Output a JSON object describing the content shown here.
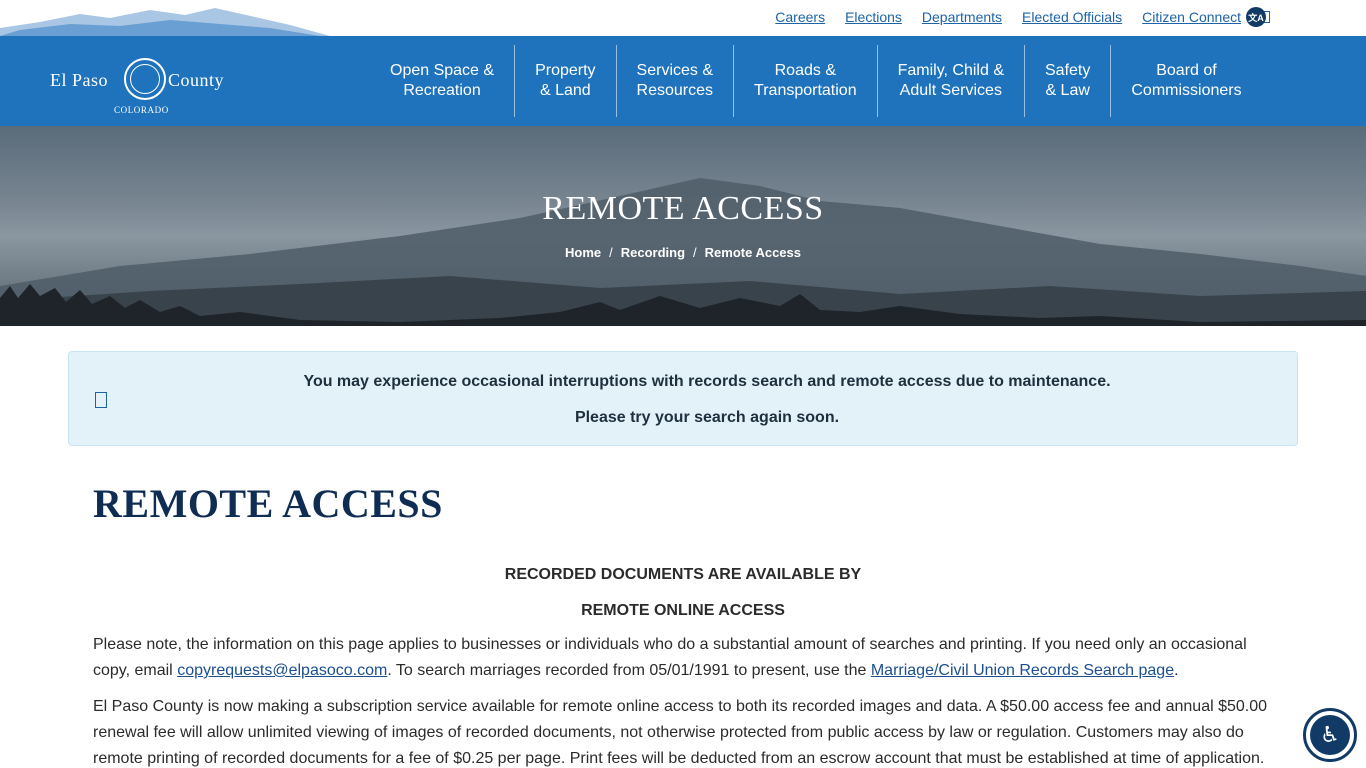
{
  "utility_nav": {
    "links": [
      "Careers",
      "Elections",
      "Departments",
      "Elected Officials",
      "Citizen Connect"
    ]
  },
  "logo": {
    "left_word": "El Paso",
    "right_word": "County",
    "subtitle": "COLORADO"
  },
  "main_nav": {
    "items": [
      {
        "line1": "Open Space &",
        "line2": "Recreation"
      },
      {
        "line1": "Property",
        "line2": "& Land"
      },
      {
        "line1": "Services &",
        "line2": "Resources"
      },
      {
        "line1": "Roads &",
        "line2": "Transportation"
      },
      {
        "line1": "Family, Child &",
        "line2": "Adult Services"
      },
      {
        "line1": "Safety",
        "line2": "& Law"
      },
      {
        "line1": "Board of",
        "line2": "Commissioners"
      }
    ]
  },
  "hero": {
    "title": "REMOTE ACCESS",
    "breadcrumb": [
      "Home",
      "Recording",
      "Remote Access"
    ]
  },
  "alert": {
    "line1": "You may experience occasional interruptions with records search and remote access due to maintenance.",
    "line2": "Please try your search again soon."
  },
  "content": {
    "heading": "REMOTE ACCESS",
    "subheading1": "RECORDED DOCUMENTS ARE AVAILABLE BY",
    "subheading2": "REMOTE ONLINE ACCESS",
    "p1_before": "Please note, the information on this page applies to businesses or individuals who do a substantial amount of searches and printing. If you need only an occasional copy, email ",
    "p1_email": "copyrequests@elpasoco.com",
    "p1_middle": ". To search marriages recorded from 05/01/1991 to present, use the ",
    "p1_link": "Marriage/Civil Union Records Search page",
    "p1_after": ".",
    "p2": "El Paso County is now making a subscription service available for remote online access to both its recorded images and data. A $50.00 access fee and annual $50.00 renewal fee will allow unlimited viewing of images of recorded documents, not otherwise protected from public access by law or regulation. Customers may also do remote printing of recorded documents for a fee of $0.25 per page. Print fees will be deducted from an escrow account that must be established at time of application."
  },
  "colors": {
    "nav_blue": "#1f73bd",
    "heading_navy": "#0f2d52",
    "alert_bg": "#e3f2f9",
    "link_blue": "#1c63a8"
  },
  "icons": {
    "search": "search-icon",
    "translate": "translate-icon",
    "alert": "info-icon",
    "accessibility": "accessibility-icon"
  }
}
